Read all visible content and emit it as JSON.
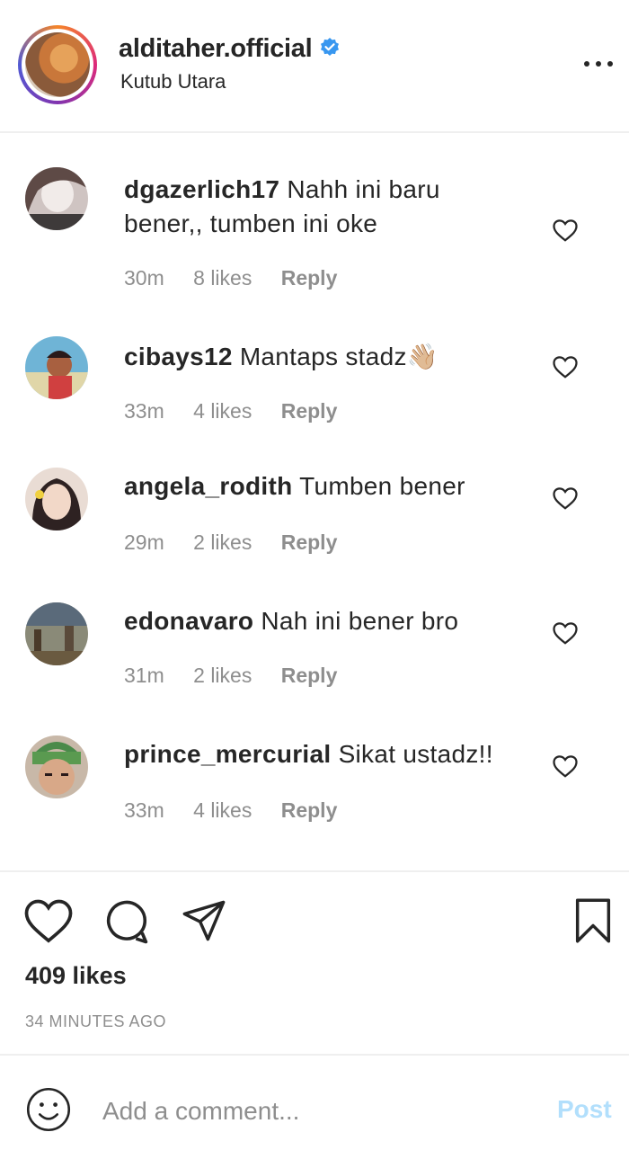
{
  "header": {
    "username": "alditaher.official",
    "location": "Kutub Utara",
    "verified": true
  },
  "comments": [
    {
      "user": "dgazerlich17",
      "text": "Nahh ini baru bener,, tumben ini oke",
      "time": "30m",
      "likes": "8 likes",
      "reply": "Reply",
      "avatar_colors": [
        "#d8c9c4",
        "#6e5a56"
      ]
    },
    {
      "user": "cibays12",
      "text": "Mantaps stadz👋🏼",
      "time": "33m",
      "likes": "4 likes",
      "reply": "Reply",
      "avatar_colors": [
        "#5aa0c8",
        "#a85a3a"
      ]
    },
    {
      "user": "angela_rodith",
      "text": "Tumben bener",
      "time": "29m",
      "likes": "2 likes",
      "reply": "Reply",
      "avatar_colors": [
        "#e8c8b8",
        "#3a2a2a"
      ]
    },
    {
      "user": "edonavaro",
      "text": "Nah ini bener bro",
      "time": "31m",
      "likes": "2 likes",
      "reply": "Reply",
      "avatar_colors": [
        "#7a7a6a",
        "#3a4a5a"
      ]
    },
    {
      "user": "prince_mercurial",
      "text": "Sikat ustadz!!",
      "time": "33m",
      "likes": "4 likes",
      "reply": "Reply",
      "avatar_colors": [
        "#5a8a4a",
        "#c89878"
      ]
    }
  ],
  "post": {
    "likes": "409 likes",
    "time": "34 MINUTES AGO"
  },
  "add_comment": {
    "placeholder": "Add a comment...",
    "post_label": "Post"
  },
  "colors": {
    "text": "#262626",
    "muted": "#8e8e8e",
    "verified": "#3897f0",
    "post_disabled": "#b2dffc"
  }
}
